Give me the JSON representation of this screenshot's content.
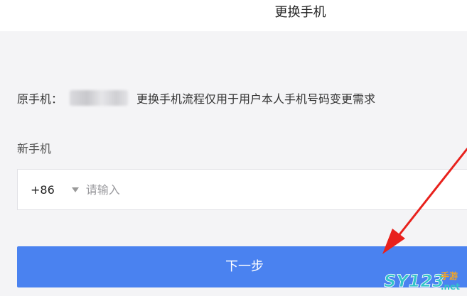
{
  "header": {
    "title": "更换手机"
  },
  "original_phone": {
    "label": "原手机：",
    "notice": "更换手机流程仅用于用户本人手机号码变更需求"
  },
  "new_phone": {
    "label": "新手机",
    "country_code": "+86",
    "input_placeholder": "请输入",
    "input_value": ""
  },
  "next_button": {
    "label": "下一步"
  },
  "watermark": {
    "main": "SY123",
    "tag": "手游",
    "domain": ".net"
  },
  "icons": {
    "dropdown": "triangle-down-icon",
    "annotation": "red-arrow-icon"
  },
  "colors": {
    "primary_button": "#4a82f0",
    "background": "#f4f4f6",
    "arrow": "#e8211c"
  }
}
